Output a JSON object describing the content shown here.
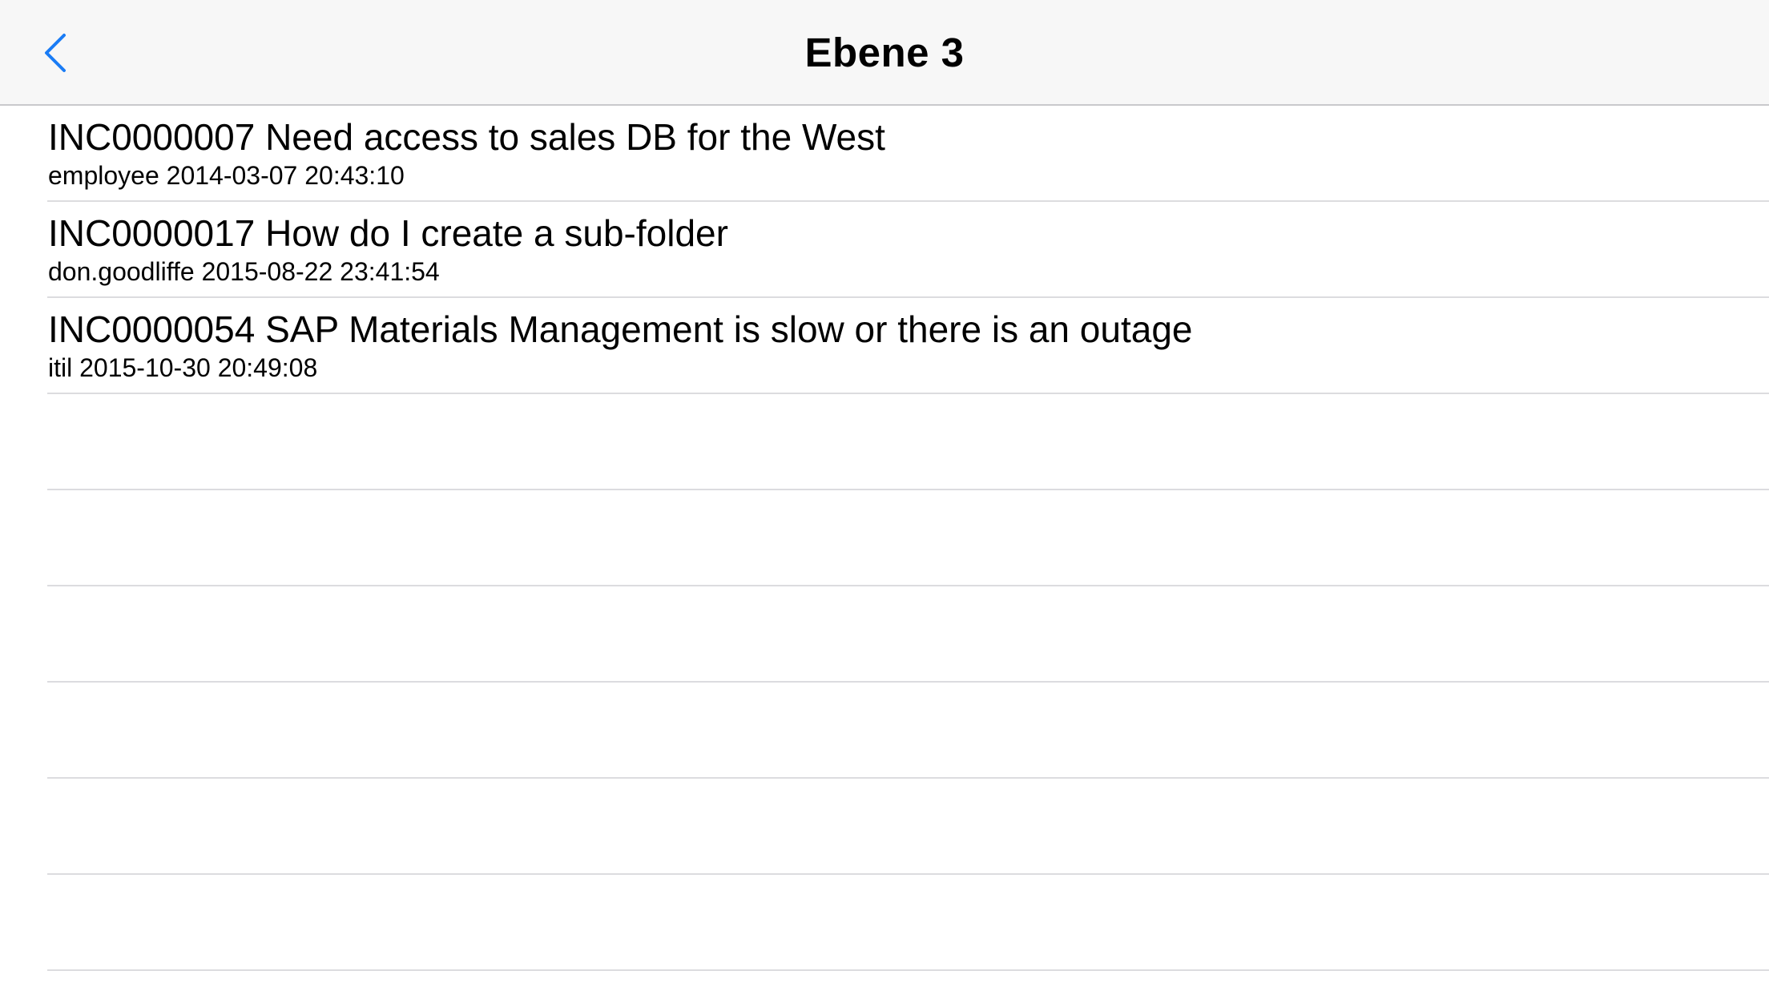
{
  "navbar": {
    "title": "Ebene 3",
    "back_icon": "chevron-left-icon",
    "accent_color": "#1a7cf5"
  },
  "incidents": [
    {
      "title": "INC0000007 Need access to sales DB for the West",
      "subtitle": "employee 2014-03-07 20:43:10"
    },
    {
      "title": "INC0000017 How do I create a sub-folder",
      "subtitle": "don.goodliffe 2015-08-22 23:41:54"
    },
    {
      "title": "INC0000054 SAP Materials Management is slow or there is an outage",
      "subtitle": "itil 2015-10-30 20:49:08"
    }
  ]
}
